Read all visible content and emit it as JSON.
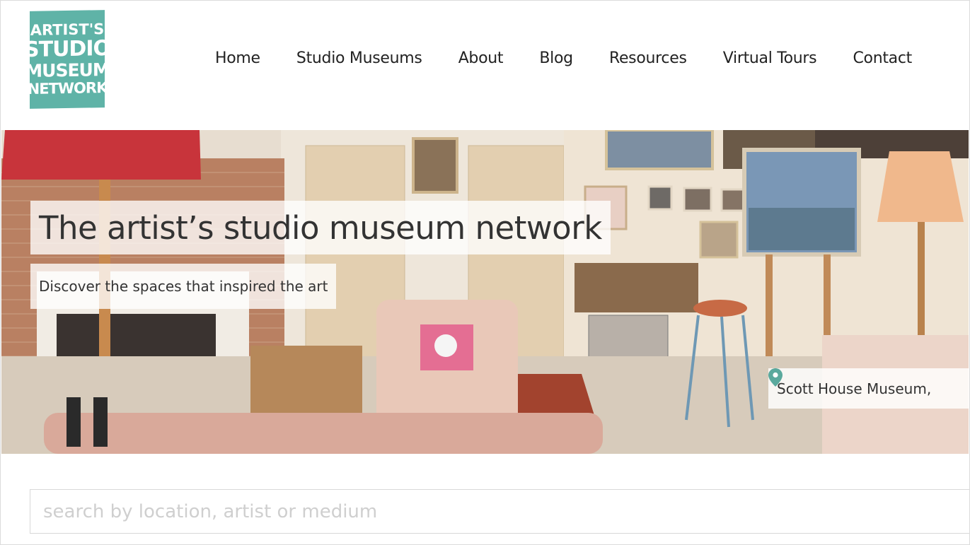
{
  "logo": {
    "line1": "ARTIST'S",
    "line2": "STUDIO",
    "line3": "MUSEUM",
    "line4": "NETWORK"
  },
  "nav": {
    "items": [
      "Home",
      "Studio Museums",
      "About",
      "Blog",
      "Resources",
      "Virtual Tours",
      "Contact"
    ]
  },
  "hero": {
    "title": "The artist’s studio museum network",
    "subtitle": "Discover the spaces that inspired the art",
    "location": "Scott House Museum,"
  },
  "search": {
    "placeholder": "search by location, artist or medium",
    "value": ""
  },
  "colors": {
    "brand_teal": "#5fb3a7",
    "pin_teal": "#5aa99d"
  },
  "icons": {
    "location": "map-pin-icon"
  }
}
